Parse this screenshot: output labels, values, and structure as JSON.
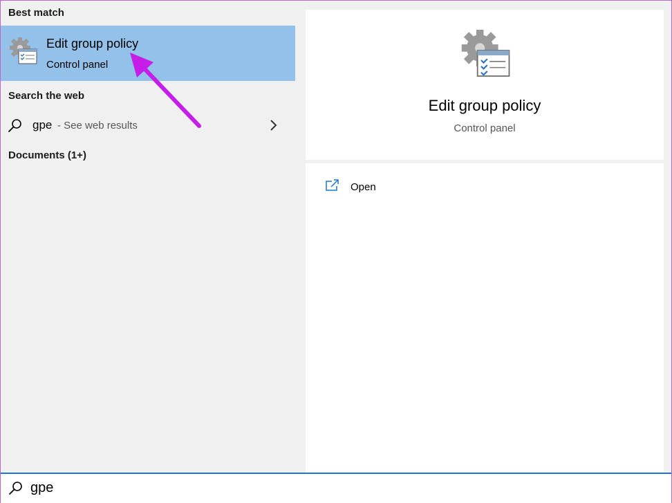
{
  "sections": {
    "best_match": "Best match",
    "search_web": "Search the web",
    "documents": "Documents (1+)"
  },
  "best_match_item": {
    "title": "Edit group policy",
    "subtitle": "Control panel",
    "icon": "group-policy-icon"
  },
  "web_result": {
    "query": "gpe",
    "hint": "- See web results",
    "icon": "search-icon",
    "chevron": "chevron-right-icon"
  },
  "preview": {
    "title": "Edit group policy",
    "subtitle": "Control panel",
    "icon": "group-policy-icon"
  },
  "actions": [
    {
      "label": "Open",
      "icon": "open-window-icon"
    }
  ],
  "search": {
    "value": "gpe"
  },
  "colors": {
    "selected": "#93c1ea",
    "accent": "#1f74cf",
    "annotation": "#c41ee8"
  }
}
